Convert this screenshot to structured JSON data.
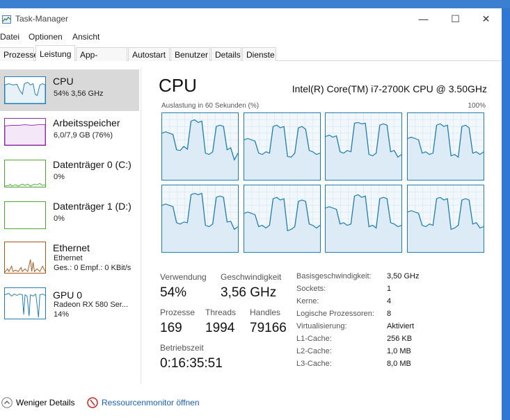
{
  "window": {
    "title": "Task-Manager",
    "controls": {
      "minimize": "—",
      "maximize": "☐",
      "close": "✕"
    }
  },
  "menu": [
    "Datei",
    "Optionen",
    "Ansicht"
  ],
  "tabs": [
    "Prozesse",
    "Leistung",
    "App-Verlauf",
    "Autostart",
    "Benutzer",
    "Details",
    "Dienste"
  ],
  "sidebar": [
    {
      "title": "CPU",
      "sub1": "54% 3,56 GHz",
      "color": "#1d7db4"
    },
    {
      "title": "Arbeitsspeicher",
      "sub1": "6,0/7,9 GB (76%)",
      "color": "#8b2fa8"
    },
    {
      "title": "Datenträger 0 (C:)",
      "sub1": "0%",
      "color": "#4da833"
    },
    {
      "title": "Datenträger 1 (D:)",
      "sub1": "0%",
      "color": "#4da833"
    },
    {
      "title": "Ethernet",
      "sub1": "Ethernet",
      "sub2": "Ges.: 0 Empf.: 0 KBit/s",
      "color": "#a7561b"
    },
    {
      "title": "GPU 0",
      "sub1": "Radeon RX 580 Ser...",
      "sub2": "14%",
      "color": "#1d7db4"
    }
  ],
  "main": {
    "heading": "CPU",
    "model": "Intel(R) Core(TM) i7-2700K CPU @ 3.50GHz",
    "graph_caption": "Auslastung in 60 Sekunden (%)",
    "graph_max": "100%",
    "stats": {
      "usage_label": "Verwendung",
      "usage_value": "54%",
      "speed_label": "Geschwindigkeit",
      "speed_value": "3,56 GHz",
      "processes_label": "Prozesse",
      "processes_value": "169",
      "threads_label": "Threads",
      "threads_value": "1994",
      "handles_label": "Handles",
      "handles_value": "79166",
      "uptime_label": "Betriebszeit",
      "uptime_value": "0:16:35:51"
    },
    "specs": [
      {
        "label": "Basisgeschwindigkeit:",
        "value": "3,50 GHz"
      },
      {
        "label": "Sockets:",
        "value": "1"
      },
      {
        "label": "Kerne:",
        "value": "4"
      },
      {
        "label": "Logische Prozessoren:",
        "value": "8"
      },
      {
        "label": "Virtualisierung:",
        "value": "Aktiviert"
      },
      {
        "label": "L1-Cache:",
        "value": "256 KB"
      },
      {
        "label": "L2-Cache:",
        "value": "1,0 MB"
      },
      {
        "label": "L3-Cache:",
        "value": "8,0 MB"
      }
    ]
  },
  "footer": {
    "fewer_details": "Weniger Details",
    "resource_monitor": "Ressourcenmonitor öffnen"
  },
  "colors": {
    "accent": "#1d7db4",
    "link": "#1a5fb4",
    "selected_bg": "#d9d9d9"
  }
}
